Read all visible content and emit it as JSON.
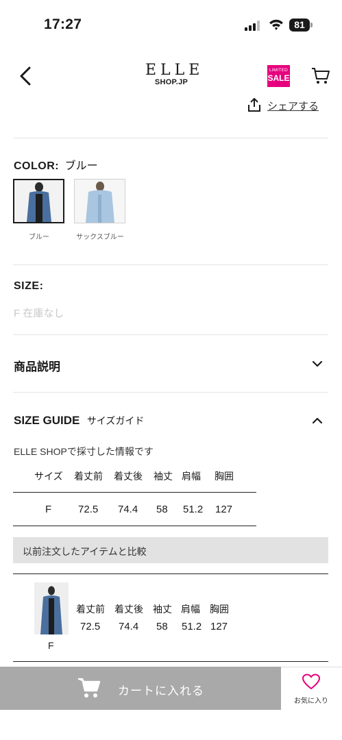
{
  "status_bar": {
    "time": "17:27",
    "battery": "81"
  },
  "header": {
    "logo_main": "ELLE",
    "logo_sub": "SHOP.JP",
    "sale_top": "LIMITED",
    "sale_main": "SALE"
  },
  "share_label": "シェアする",
  "color": {
    "label": "COLOR:",
    "value": "ブルー",
    "options": [
      {
        "name": "ブルー",
        "tone": "#4a6f9e"
      },
      {
        "name": "サックスブルー",
        "tone": "#a9c6e0"
      }
    ]
  },
  "size": {
    "label": "SIZE:",
    "option": "F 在庫なし"
  },
  "description": {
    "title": "商品説明"
  },
  "size_guide": {
    "title": "SIZE GUIDE",
    "subtitle": "サイズガイド",
    "note": "ELLE SHOPで採寸した情報です",
    "headers": [
      "サイズ",
      "着丈前",
      "着丈後",
      "袖丈",
      "肩幅",
      "胸囲"
    ],
    "row": [
      "F",
      "72.5",
      "74.4",
      "58",
      "51.2",
      "127"
    ]
  },
  "compare": {
    "title": "以前注文したアイテムと比較",
    "headers": [
      "着丈前",
      "着丈後",
      "袖丈",
      "肩幅",
      "胸囲"
    ],
    "values": [
      "72.5",
      "74.4",
      "58",
      "51.2",
      "127"
    ],
    "size": "F"
  },
  "bottom": {
    "cart_label": "カートに入れる",
    "fav_label": "お気に入り"
  },
  "colors": {
    "sale_pink": "#e6007e",
    "cart_button": "#a9a9a9",
    "heart": "#e6007e"
  }
}
